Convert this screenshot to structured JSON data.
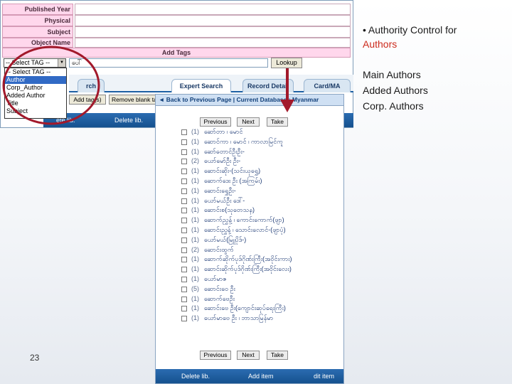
{
  "slide": {
    "heading_prefix": "•",
    "heading_main": "Authority Control for",
    "heading_accent": "Authors",
    "accent_color": "#cc2a1c",
    "authors": [
      "Main Authors",
      "Added Authors",
      "Corp. Authors"
    ],
    "page_number": "23"
  },
  "form": {
    "fields": [
      "Published Year",
      "Physical",
      "Subject",
      "Object Name"
    ],
    "add_tags_label": "Add Tags",
    "tag_select_value": "-- Select TAG --",
    "tag_options": [
      "-- Select TAG --",
      "Author",
      "Corp_Author",
      "Added Author",
      "Title",
      "Subject"
    ],
    "selected_option": "Author",
    "tag_input_value": "ပေါ်",
    "lookup_label": "Lookup",
    "tabs": [
      "rch",
      "Expert Search",
      "Record Detail",
      "Card/MA"
    ],
    "add_tag_button": "Add tag(s)",
    "remove_blank_button": "Remove blank ta",
    "bottom_bar": [
      "ete lib.",
      "Delete lib."
    ]
  },
  "popup": {
    "header": "◄ Back to Previous Page | Current Database : Myanmar",
    "nav": {
      "previous": "Previous",
      "next": "Next",
      "take": "Take"
    },
    "results": [
      {
        "count": "(1)",
        "name": "ဆော်တာ ၊ မောင်"
      },
      {
        "count": "(1)",
        "name": "ဆောင်ကာ ၊ မောင် ၊ ကာလာမြင်ကူ"
      },
      {
        "count": "(1)",
        "name": "ဆော်တောင်ဦးဦး-"
      },
      {
        "count": "(2)",
        "name": "ယော်မော်ဦး ဦး-"
      },
      {
        "count": "(1)",
        "name": "ဆောင်းဆိုး-(သင်းယုရွှေ)"
      },
      {
        "count": "(1)",
        "name": "ဆောက်ဒေး ဦး (အကြမ်း)"
      },
      {
        "count": "(1)",
        "name": "ဆောင်းရွှေဦး-"
      },
      {
        "count": "(1)",
        "name": "ယော်မယ်ဦး ဒေါ်-"
      },
      {
        "count": "(1)",
        "name": "ဆောင်းစ(သုတေသန)"
      },
      {
        "count": "(1)",
        "name": "ဆောက်ညွှန့် ၊ ကောင်းကောက်(ဖျာ)"
      },
      {
        "count": "(1)",
        "name": "ဆောင်းညွှန့် ၊ သောင်းလောင်-(ဖျာပုံ)"
      },
      {
        "count": "(1)",
        "name": "ယော်မယ်(မြူပိုဒ်-)"
      },
      {
        "count": "(2)",
        "name": "ဆောင်းထွက်"
      },
      {
        "count": "(1)",
        "name": "ဆောက်ဆိုက်ပုဒ်ဂိုဏ်းကြီး(အဝိုင်းကား)"
      },
      {
        "count": "(1)",
        "name": "ဆောင်းဆိုက်ပုဒ်ဂိုဏ်းကြီး(အဝိုင်းလေး)"
      },
      {
        "count": "(1)",
        "name": "ယော်မာဇ"
      },
      {
        "count": "(5)",
        "name": "ဆောင်းဝေ ဦး"
      },
      {
        "count": "(1)",
        "name": "ဆောက်ဗေဦး"
      },
      {
        "count": "(1)",
        "name": "ဆောင်းဗေ ဦး(ကျောင်းဆုပ်ရေးကြီး)"
      },
      {
        "count": "(1)",
        "name": "ယော်မာဗေ ဦး ၊ ဘာသာမြန်မာ"
      }
    ],
    "bottom_bar": [
      "Delete lib.",
      "Add item",
      "dit item"
    ]
  }
}
